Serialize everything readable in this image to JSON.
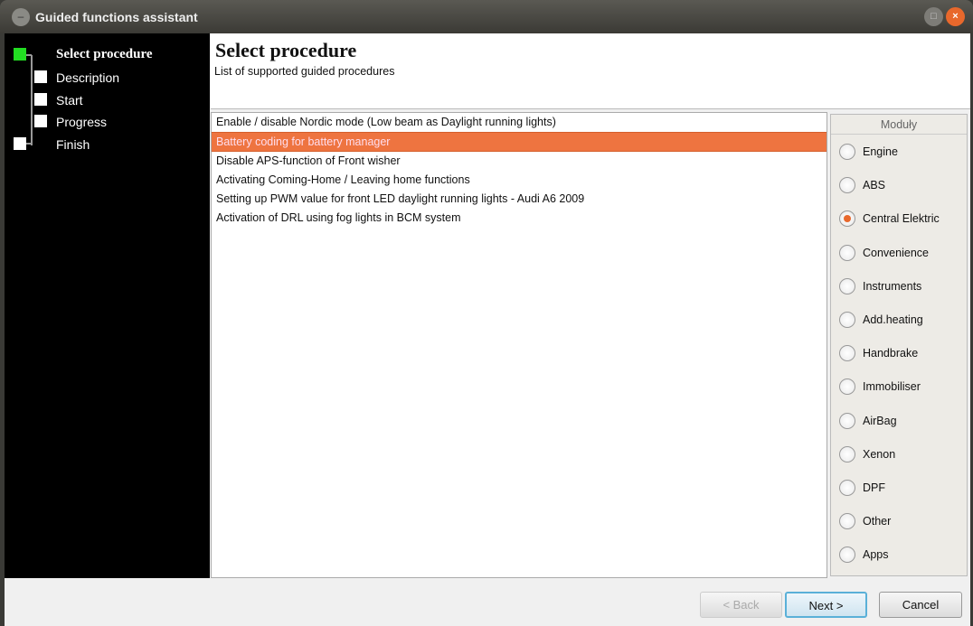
{
  "window": {
    "title": "Guided functions assistant"
  },
  "steps": [
    {
      "label": "Select procedure",
      "state": "active",
      "color": "#22dd22"
    },
    {
      "label": "Description"
    },
    {
      "label": "Start"
    },
    {
      "label": "Progress"
    },
    {
      "label": "Finish"
    }
  ],
  "header": {
    "title": "Select procedure",
    "subtitle": "List of supported guided procedures"
  },
  "procedures": [
    "Enable / disable Nordic mode (Low beam as Daylight running lights)",
    "Battery coding for battery manager",
    "Disable APS-function of Front wisher",
    "Activating Coming-Home / Leaving home  functions",
    "Setting up PWM value for front LED daylight running lights - Audi A6 2009",
    "Activation of DRL using fog lights in BCM system"
  ],
  "selected_procedure": 1,
  "modules": {
    "title": "Moduły",
    "selected": 2,
    "items": [
      "Engine",
      "ABS",
      "Central Elektric",
      "Convenience",
      "Instruments",
      "Add.heating",
      "Handbrake",
      "Immobiliser",
      "AirBag",
      "Xenon",
      "DPF",
      "Other",
      "Apps"
    ]
  },
  "buttons": {
    "back": "< Back",
    "next": "Next >",
    "cancel": "Cancel"
  },
  "colors": {
    "accent": "#ee7440",
    "active_step": "#22dd22"
  }
}
